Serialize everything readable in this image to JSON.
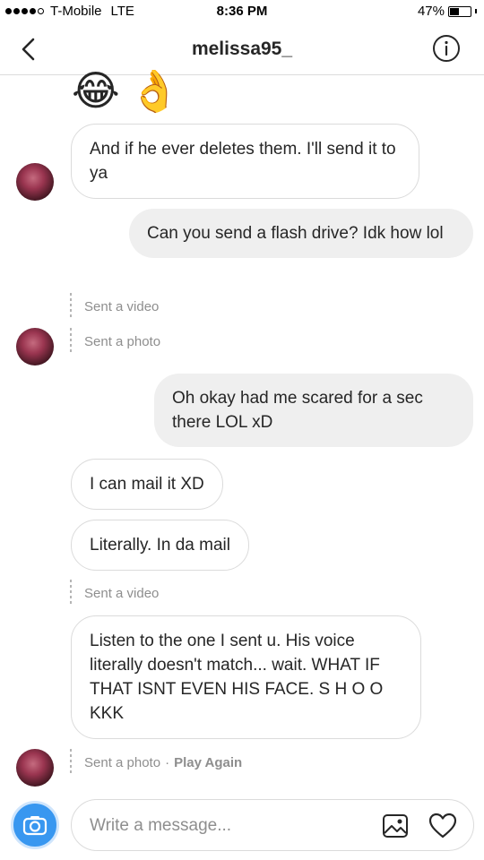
{
  "status_bar": {
    "carrier": "T-Mobile",
    "network": "LTE",
    "time": "8:36 PM",
    "battery_text": "47%",
    "battery_level": 0.47,
    "signal_bars_filled": 4,
    "signal_bars_total": 5
  },
  "header": {
    "title": "melissa95_",
    "back_icon": "chevron-left-icon",
    "info_icon": "info-icon"
  },
  "messages": {
    "emojis": [
      "😂",
      "👌"
    ],
    "m1": "And if he ever deletes them. I'll send it to ya",
    "m2": "Can you send a flash drive? Idk how lol",
    "m3": "Sent a video",
    "m4": "Sent a photo",
    "m5": "Oh okay had me scared for a sec there LOL xD",
    "m6": "I can mail it XD",
    "m7": "Literally. In da mail",
    "m8": "Sent a video",
    "m9": "Listen to the one I sent u. His voice literally doesn't match... wait. WHAT IF THAT ISNT EVEN HIS FACE. S H O O KKK",
    "m10": "Sent a photo",
    "m10_separator": "·",
    "m10_action": "Play Again"
  },
  "composer": {
    "placeholder": "Write a message...",
    "camera_icon": "camera-icon",
    "gallery_icon": "image-icon",
    "heart_icon": "heart-icon"
  },
  "colors": {
    "accent": "#3897f0",
    "incoming_border": "#dbdbdb",
    "outgoing_bg": "#efefef",
    "meta_text": "#8e8e8e"
  }
}
